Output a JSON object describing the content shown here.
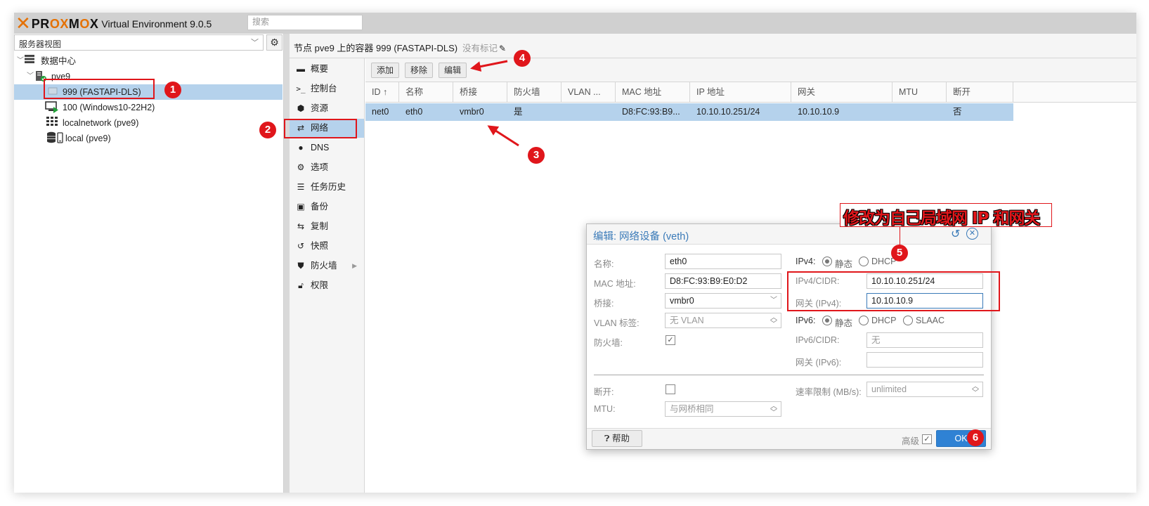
{
  "app": {
    "logo_text": "PROXMOX",
    "title": "Virtual Environment 9.0.5",
    "search_placeholder": "搜索"
  },
  "left_panel": {
    "view_selector": "服务器视图",
    "tree": [
      {
        "label": "数据中心",
        "icon": "datacenter-icon"
      },
      {
        "label": "pve9",
        "icon": "node-icon"
      },
      {
        "label": "999 (FASTAPI-DLS)",
        "icon": "container-icon",
        "selected": true
      },
      {
        "label": "100 (Windows10-22H2)",
        "icon": "vm-running-icon"
      },
      {
        "label": "localnetwork (pve9)",
        "icon": "sdn-grid-icon"
      },
      {
        "label": "local (pve9)",
        "icon": "storage-icon"
      }
    ]
  },
  "header": {
    "breadcrumb": "节点 pve9 上的容器 999 (FASTAPI-DLS)",
    "tags": "没有标记"
  },
  "subnav": [
    {
      "label": "概要",
      "icon": "book-icon"
    },
    {
      "label": "控制台",
      "icon": "terminal-icon"
    },
    {
      "label": "资源",
      "icon": "cube-icon"
    },
    {
      "label": "网络",
      "icon": "exchange-icon",
      "selected": true
    },
    {
      "label": "DNS",
      "icon": "globe-icon"
    },
    {
      "label": "选项",
      "icon": "gear-icon"
    },
    {
      "label": "任务历史",
      "icon": "list-icon"
    },
    {
      "label": "备份",
      "icon": "floppy-icon"
    },
    {
      "label": "复制",
      "icon": "retweet-icon"
    },
    {
      "label": "快照",
      "icon": "history-icon"
    },
    {
      "label": "防火墙",
      "icon": "shield-icon",
      "has_submenu": true
    },
    {
      "label": "权限",
      "icon": "unlock-icon"
    }
  ],
  "toolbar": {
    "add_label": "添加",
    "remove_label": "移除",
    "edit_label": "编辑"
  },
  "grid": {
    "columns": [
      "ID",
      "名称",
      "桥接",
      "防火墙",
      "VLAN ...",
      "MAC 地址",
      "IP 地址",
      "网关",
      "MTU",
      "断开"
    ],
    "sort_indicator": "↑",
    "rows": [
      {
        "id": "net0",
        "name": "eth0",
        "bridge": "vmbr0",
        "firewall": "是",
        "vlan": "",
        "mac": "D8:FC:93:B9...",
        "ip": "10.10.10.251/24",
        "gateway": "10.10.10.9",
        "mtu": "",
        "disconnect": "否"
      }
    ]
  },
  "dialog": {
    "title": "编辑: 网络设备 (veth)",
    "name_label": "名称:",
    "name_value": "eth0",
    "mac_label": "MAC 地址:",
    "mac_value": "D8:FC:93:B9:E0:D2",
    "bridge_label": "桥接:",
    "bridge_value": "vmbr0",
    "vlan_label": "VLAN 标签:",
    "vlan_value": "无 VLAN",
    "firewall_label": "防火墙:",
    "firewall_checked": true,
    "ipv4_label": "IPv4:",
    "ipv4_static": "静态",
    "ipv4_dhcp": "DHCP",
    "ipv4_cidr_label": "IPv4/CIDR:",
    "ipv4_cidr_value": "10.10.10.251/24",
    "gw4_label": "网关 (IPv4):",
    "gw4_value": "10.10.10.9",
    "ipv6_label": "IPv6:",
    "ipv6_static": "静态",
    "ipv6_dhcp": "DHCP",
    "ipv6_slaac": "SLAAC",
    "ipv6_cidr_label": "IPv6/CIDR:",
    "ipv6_cidr_value": "无",
    "gw6_label": "网关 (IPv6):",
    "gw6_value": "",
    "disconnect_label": "断开:",
    "mtu_label": "MTU:",
    "mtu_value": "与网桥相同",
    "rate_label": "速率限制 (MB/s):",
    "rate_value": "unlimited",
    "help_label": "帮助",
    "advanced_label": "高级",
    "ok_label": "OK"
  },
  "annotations": {
    "callout_text": "修改为自己局域网 IP 和网关",
    "badges": [
      "1",
      "2",
      "3",
      "4",
      "5",
      "6"
    ],
    "accent_color": "#e0161b"
  }
}
